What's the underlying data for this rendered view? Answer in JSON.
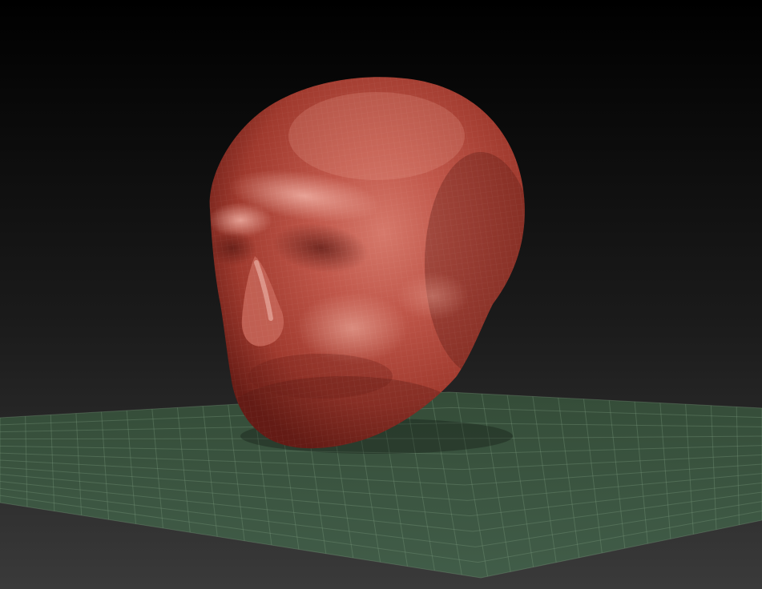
{
  "viewport": {
    "background_top": "#000000",
    "background_bottom": "#3a3a3a",
    "floor_grid_color": "#3d5a41",
    "floor_grid_lines": "#6d8c70",
    "model_material_color": "#b5483a",
    "model_highlight_color": "#d8857a",
    "model_shadow_color": "#5a1a14",
    "wireframe_overlay": true,
    "model_icon": "skull-mesh-icon"
  }
}
